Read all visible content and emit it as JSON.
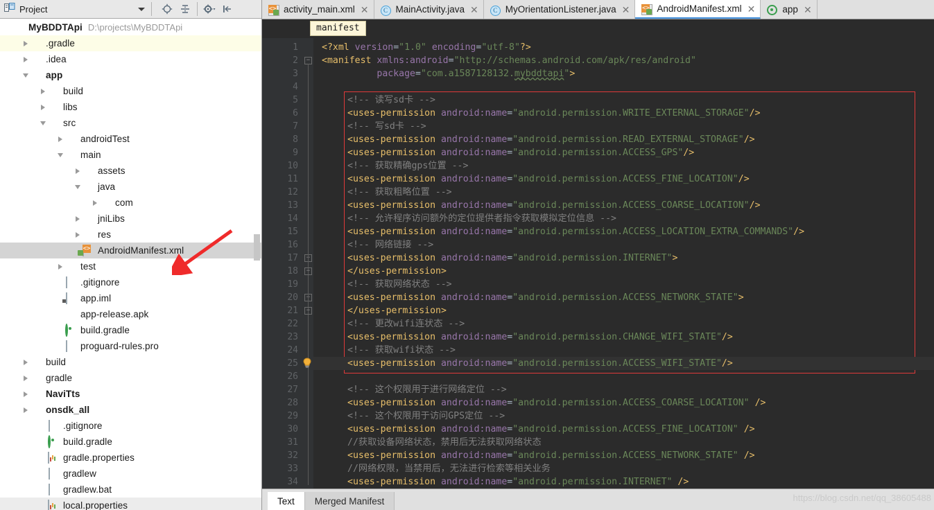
{
  "project_panel": {
    "title": "Project",
    "toolbar_icons": [
      "locate-icon",
      "collapse-all-icon",
      "settings-gear-icon",
      "hide-panel-icon"
    ],
    "root": {
      "name": "MyBDDTApi",
      "path": "D:\\projects\\MyBDDTApi"
    },
    "tree": [
      {
        "label": ".gradle",
        "icon": "folder-red-icon",
        "indent": 1,
        "state": "collapsed",
        "highlight": "yellow"
      },
      {
        "label": ".idea",
        "icon": "folder-icon",
        "indent": 1,
        "state": "collapsed",
        "highlight": "none"
      },
      {
        "label": "app",
        "icon": "module-app-icon",
        "indent": 1,
        "state": "expanded",
        "highlight": "none",
        "bold": true
      },
      {
        "label": "build",
        "icon": "folder-icon",
        "indent": 2,
        "state": "collapsed",
        "highlight": "none"
      },
      {
        "label": "libs",
        "icon": "folder-icon",
        "indent": 2,
        "state": "collapsed",
        "highlight": "none"
      },
      {
        "label": "src",
        "icon": "folder-icon",
        "indent": 2,
        "state": "expanded",
        "highlight": "none"
      },
      {
        "label": "androidTest",
        "icon": "folder-icon",
        "indent": 3,
        "state": "collapsed",
        "highlight": "none"
      },
      {
        "label": "main",
        "icon": "folder-icon",
        "indent": 3,
        "state": "expanded",
        "highlight": "none"
      },
      {
        "label": "assets",
        "icon": "folder-res-icon",
        "indent": 4,
        "state": "collapsed",
        "highlight": "none"
      },
      {
        "label": "java",
        "icon": "folder-blue-icon",
        "indent": 4,
        "state": "expanded",
        "highlight": "none"
      },
      {
        "label": "com",
        "icon": "folder-package-icon",
        "indent": 5,
        "state": "collapsed",
        "highlight": "none"
      },
      {
        "label": "jniLibs",
        "icon": "folder-icon",
        "indent": 4,
        "state": "collapsed",
        "highlight": "none"
      },
      {
        "label": "res",
        "icon": "folder-res-icon",
        "indent": 4,
        "state": "collapsed",
        "highlight": "none"
      },
      {
        "label": "AndroidManifest.xml",
        "icon": "android-manifest-icon",
        "indent": 4,
        "state": "leaf",
        "highlight": "grey"
      },
      {
        "label": "test",
        "icon": "folder-icon",
        "indent": 3,
        "state": "collapsed",
        "highlight": "none"
      },
      {
        "label": ".gitignore",
        "icon": "text-file-icon",
        "indent": 3,
        "state": "leaf",
        "highlight": "none"
      },
      {
        "label": "app.iml",
        "icon": "iml-file-icon",
        "indent": 3,
        "state": "leaf",
        "highlight": "none"
      },
      {
        "label": "app-release.apk",
        "icon": "apk-file-icon",
        "indent": 3,
        "state": "leaf",
        "highlight": "none"
      },
      {
        "label": "build.gradle",
        "icon": "gradle-file-icon",
        "indent": 3,
        "state": "leaf",
        "highlight": "none"
      },
      {
        "label": "proguard-rules.pro",
        "icon": "text-file-icon",
        "indent": 3,
        "state": "leaf",
        "highlight": "none"
      },
      {
        "label": "build",
        "icon": "folder-icon",
        "indent": 1,
        "state": "collapsed",
        "highlight": "none"
      },
      {
        "label": "gradle",
        "icon": "folder-icon",
        "indent": 1,
        "state": "collapsed",
        "highlight": "none"
      },
      {
        "label": "NaviTts",
        "icon": "module-icon",
        "indent": 1,
        "state": "collapsed",
        "highlight": "none",
        "bold": true
      },
      {
        "label": "onsdk_all",
        "icon": "module-icon",
        "indent": 1,
        "state": "collapsed",
        "highlight": "none",
        "bold": true
      },
      {
        "label": ".gitignore",
        "icon": "text-file-icon",
        "indent": 2,
        "state": "leaf",
        "highlight": "none"
      },
      {
        "label": "build.gradle",
        "icon": "gradle-file-icon",
        "indent": 2,
        "state": "leaf",
        "highlight": "none"
      },
      {
        "label": "gradle.properties",
        "icon": "properties-file-icon",
        "indent": 2,
        "state": "leaf",
        "highlight": "none"
      },
      {
        "label": "gradlew",
        "icon": "text-file-icon",
        "indent": 2,
        "state": "leaf",
        "highlight": "none"
      },
      {
        "label": "gradlew.bat",
        "icon": "text-file-icon",
        "indent": 2,
        "state": "leaf",
        "highlight": "none"
      },
      {
        "label": "local.properties",
        "icon": "properties-file-icon",
        "indent": 2,
        "state": "leaf",
        "highlight": "grey2"
      }
    ]
  },
  "editor_tabs": [
    {
      "label": "activity_main.xml",
      "icon": "android-xml-icon",
      "active": false,
      "closable": true
    },
    {
      "label": "MainActivity.java",
      "icon": "java-class-icon",
      "active": false,
      "closable": true
    },
    {
      "label": "MyOrientationListener.java",
      "icon": "java-class-icon",
      "active": false,
      "closable": true
    },
    {
      "label": "AndroidManifest.xml",
      "icon": "android-manifest-icon",
      "active": true,
      "closable": true
    },
    {
      "label": "app",
      "icon": "gradle-file-icon",
      "active": false,
      "closable": true
    }
  ],
  "breadcrumb": {
    "label": "manifest"
  },
  "code": {
    "first_line": 1,
    "highlight_line": 25,
    "bulb_line": 25,
    "lines": [
      {
        "n": 1,
        "indent": 0,
        "spans": [
          {
            "c": "pi",
            "t": "<?xml "
          },
          {
            "c": "attr",
            "t": "version"
          },
          {
            "c": "eq",
            "t": "="
          },
          {
            "c": "str",
            "t": "\"1.0\""
          },
          {
            "c": "plain",
            "t": " "
          },
          {
            "c": "attr",
            "t": "encoding"
          },
          {
            "c": "eq",
            "t": "="
          },
          {
            "c": "str",
            "t": "\"utf-8\""
          },
          {
            "c": "pi",
            "t": "?>"
          }
        ]
      },
      {
        "n": 2,
        "indent": 0,
        "spans": [
          {
            "c": "tag",
            "t": "<manifest "
          },
          {
            "c": "attr",
            "t": "xmlns:android"
          },
          {
            "c": "eq",
            "t": "="
          },
          {
            "c": "str",
            "t": "\"http://schemas.android.com/apk/res/android\""
          }
        ]
      },
      {
        "n": 3,
        "indent": 0,
        "spans": [
          {
            "c": "plain",
            "t": "          "
          },
          {
            "c": "attr",
            "t": "package"
          },
          {
            "c": "eq",
            "t": "="
          },
          {
            "c": "str",
            "t": "\"com.a1587128132."
          },
          {
            "c": "str squig",
            "t": "mybddtapi"
          },
          {
            "c": "str",
            "t": "\""
          },
          {
            "c": "tag",
            "t": ">"
          }
        ]
      },
      {
        "n": 4,
        "indent": 0,
        "spans": []
      },
      {
        "n": 5,
        "indent": 1,
        "spans": [
          {
            "c": "cmt",
            "t": "<!-- 读写sd卡 -->"
          }
        ]
      },
      {
        "n": 6,
        "indent": 1,
        "spans": [
          {
            "c": "tag",
            "t": "<uses-permission "
          },
          {
            "c": "attr",
            "t": "android:name"
          },
          {
            "c": "eq",
            "t": "="
          },
          {
            "c": "str",
            "t": "\"android.permission.WRITE_EXTERNAL_STORAGE\""
          },
          {
            "c": "slash",
            "t": "/>"
          }
        ]
      },
      {
        "n": 7,
        "indent": 1,
        "spans": [
          {
            "c": "cmt",
            "t": "<!-- 写sd卡 -->"
          }
        ]
      },
      {
        "n": 8,
        "indent": 1,
        "spans": [
          {
            "c": "tag",
            "t": "<uses-permission "
          },
          {
            "c": "attr",
            "t": "android:name"
          },
          {
            "c": "eq",
            "t": "="
          },
          {
            "c": "str",
            "t": "\"android.permission.READ_EXTERNAL_STORAGE\""
          },
          {
            "c": "slash",
            "t": "/>"
          }
        ]
      },
      {
        "n": 9,
        "indent": 1,
        "spans": [
          {
            "c": "tag",
            "t": "<uses-permission "
          },
          {
            "c": "attr",
            "t": "android:name"
          },
          {
            "c": "eq",
            "t": "="
          },
          {
            "c": "str",
            "t": "\"android.permission.ACCESS_GPS\""
          },
          {
            "c": "slash",
            "t": "/>"
          }
        ]
      },
      {
        "n": 10,
        "indent": 1,
        "spans": [
          {
            "c": "cmt",
            "t": "<!-- 获取精确gps位置 -->"
          }
        ]
      },
      {
        "n": 11,
        "indent": 1,
        "spans": [
          {
            "c": "tag",
            "t": "<uses-permission "
          },
          {
            "c": "attr",
            "t": "android:name"
          },
          {
            "c": "eq",
            "t": "="
          },
          {
            "c": "str",
            "t": "\"android.permission.ACCESS_FINE_LOCATION\""
          },
          {
            "c": "slash",
            "t": "/>"
          }
        ]
      },
      {
        "n": 12,
        "indent": 1,
        "spans": [
          {
            "c": "cmt",
            "t": "<!-- 获取粗略位置 -->"
          }
        ]
      },
      {
        "n": 13,
        "indent": 1,
        "spans": [
          {
            "c": "tag",
            "t": "<uses-permission "
          },
          {
            "c": "attr",
            "t": "android:name"
          },
          {
            "c": "eq",
            "t": "="
          },
          {
            "c": "str",
            "t": "\"android.permission.ACCESS_COARSE_LOCATION\""
          },
          {
            "c": "slash",
            "t": "/>"
          }
        ]
      },
      {
        "n": 14,
        "indent": 1,
        "spans": [
          {
            "c": "cmt",
            "t": "<!-- 允许程序访问额外的定位提供者指令获取模拟定位信息 -->"
          }
        ]
      },
      {
        "n": 15,
        "indent": 1,
        "spans": [
          {
            "c": "tag",
            "t": "<uses-permission "
          },
          {
            "c": "attr",
            "t": "android:name"
          },
          {
            "c": "eq",
            "t": "="
          },
          {
            "c": "str",
            "t": "\"android.permission.ACCESS_LOCATION_EXTRA_COMMANDS\""
          },
          {
            "c": "slash",
            "t": "/>"
          }
        ]
      },
      {
        "n": 16,
        "indent": 1,
        "spans": [
          {
            "c": "cmt",
            "t": "<!-- 网络链接 -->"
          }
        ]
      },
      {
        "n": 17,
        "indent": 1,
        "spans": [
          {
            "c": "tag",
            "t": "<uses-permission "
          },
          {
            "c": "attr",
            "t": "android:name"
          },
          {
            "c": "eq",
            "t": "="
          },
          {
            "c": "str",
            "t": "\"android.permission.INTERNET\""
          },
          {
            "c": "tag",
            "t": ">"
          }
        ]
      },
      {
        "n": 18,
        "indent": 1,
        "spans": [
          {
            "c": "tag",
            "t": "</uses-permission>"
          }
        ]
      },
      {
        "n": 19,
        "indent": 1,
        "spans": [
          {
            "c": "cmt",
            "t": "<!-- 获取网络状态 -->"
          }
        ]
      },
      {
        "n": 20,
        "indent": 1,
        "spans": [
          {
            "c": "tag",
            "t": "<uses-permission "
          },
          {
            "c": "attr",
            "t": "android:name"
          },
          {
            "c": "eq",
            "t": "="
          },
          {
            "c": "str",
            "t": "\"android.permission.ACCESS_NETWORK_STATE\""
          },
          {
            "c": "tag",
            "t": ">"
          }
        ]
      },
      {
        "n": 21,
        "indent": 1,
        "spans": [
          {
            "c": "tag",
            "t": "</uses-permission>"
          }
        ]
      },
      {
        "n": 22,
        "indent": 1,
        "spans": [
          {
            "c": "cmt",
            "t": "<!-- 更改wifi连状态 -->"
          }
        ]
      },
      {
        "n": 23,
        "indent": 1,
        "spans": [
          {
            "c": "tag",
            "t": "<uses-permission "
          },
          {
            "c": "attr",
            "t": "android:name"
          },
          {
            "c": "eq",
            "t": "="
          },
          {
            "c": "str",
            "t": "\"android.permission.CHANGE_WIFI_STATE\""
          },
          {
            "c": "slash",
            "t": "/>"
          }
        ]
      },
      {
        "n": 24,
        "indent": 1,
        "spans": [
          {
            "c": "cmt",
            "t": "<!-- 获取wifi状态 -->"
          }
        ]
      },
      {
        "n": 25,
        "indent": 1,
        "spans": [
          {
            "c": "tag",
            "t": "<uses-permission "
          },
          {
            "c": "attr",
            "t": "android:name"
          },
          {
            "c": "eq",
            "t": "="
          },
          {
            "c": "str",
            "t": "\"android.permission.ACCESS_WIFI_STATE\""
          },
          {
            "c": "slash",
            "t": "/>"
          }
        ]
      },
      {
        "n": 26,
        "indent": 1,
        "spans": []
      },
      {
        "n": 27,
        "indent": 1,
        "spans": [
          {
            "c": "cmt",
            "t": "<!-- 这个权限用于进行网络定位 -->"
          }
        ]
      },
      {
        "n": 28,
        "indent": 1,
        "spans": [
          {
            "c": "tag",
            "t": "<uses-permission "
          },
          {
            "c": "attr",
            "t": "android:name"
          },
          {
            "c": "eq",
            "t": "="
          },
          {
            "c": "str",
            "t": "\"android.permission.ACCESS_COARSE_LOCATION\""
          },
          {
            "c": "plain",
            "t": " "
          },
          {
            "c": "slash",
            "t": "/>"
          }
        ]
      },
      {
        "n": 29,
        "indent": 1,
        "spans": [
          {
            "c": "cmt",
            "t": "<!-- 这个权限用于访问GPS定位 -->"
          }
        ]
      },
      {
        "n": 30,
        "indent": 1,
        "spans": [
          {
            "c": "tag",
            "t": "<uses-permission "
          },
          {
            "c": "attr",
            "t": "android:name"
          },
          {
            "c": "eq",
            "t": "="
          },
          {
            "c": "str",
            "t": "\"android.permission.ACCESS_FINE_LOCATION\""
          },
          {
            "c": "plain",
            "t": " "
          },
          {
            "c": "slash",
            "t": "/>"
          }
        ]
      },
      {
        "n": 31,
        "indent": 1,
        "spans": [
          {
            "c": "cmt",
            "t": "//获取设备网络状态，禁用后无法获取网络状态"
          }
        ]
      },
      {
        "n": 32,
        "indent": 1,
        "spans": [
          {
            "c": "tag",
            "t": "<uses-permission "
          },
          {
            "c": "attr",
            "t": "android:name"
          },
          {
            "c": "eq",
            "t": "="
          },
          {
            "c": "str",
            "t": "\"android.permission.ACCESS_NETWORK_STATE\""
          },
          {
            "c": "plain",
            "t": " "
          },
          {
            "c": "slash",
            "t": "/>"
          }
        ]
      },
      {
        "n": 33,
        "indent": 1,
        "spans": [
          {
            "c": "cmt",
            "t": "//网络权限，当禁用后，无法进行检索等相关业务"
          }
        ]
      },
      {
        "n": 34,
        "indent": 1,
        "spans": [
          {
            "c": "tag",
            "t": "<uses-permission "
          },
          {
            "c": "attr",
            "t": "android:name"
          },
          {
            "c": "eq",
            "t": "="
          },
          {
            "c": "str",
            "t": "\"android.permission.INTERNET\""
          },
          {
            "c": "plain",
            "t": " "
          },
          {
            "c": "slash",
            "t": "/>"
          }
        ]
      }
    ]
  },
  "bottom_tabs": [
    {
      "label": "Text",
      "active": true
    },
    {
      "label": "Merged Manifest",
      "active": false
    }
  ],
  "watermark": "https://blog.csdn.net/qq_38605488",
  "colors": {
    "editor_bg": "#2b2b2b",
    "gutter_bg": "#313335",
    "tag": "#e8bf6a",
    "attribute": "#9876aa",
    "string": "#6a8759",
    "comment": "#808080",
    "selection_box": "#e03a3a",
    "tab_active_underline": "#3b8ad8"
  }
}
